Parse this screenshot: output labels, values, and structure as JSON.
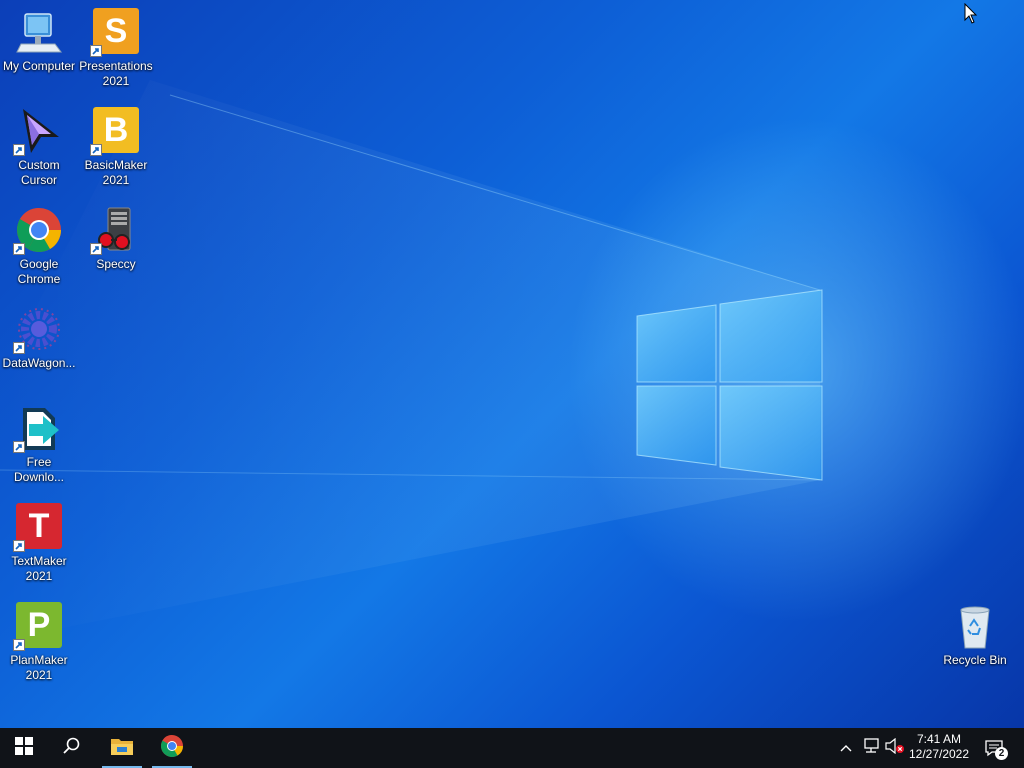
{
  "desktop": {
    "icons": [
      {
        "id": "my-computer",
        "label": "My Computer"
      },
      {
        "id": "presentations",
        "label": "Presentations 2021",
        "letter": "S"
      },
      {
        "id": "custom-cursor",
        "label": "Custom Cursor"
      },
      {
        "id": "basicmaker",
        "label": "BasicMaker 2021",
        "letter": "B"
      },
      {
        "id": "google-chrome",
        "label": "Google Chrome"
      },
      {
        "id": "speccy",
        "label": "Speccy"
      },
      {
        "id": "datawagon",
        "label": "DataWagon..."
      },
      {
        "id": "free-download",
        "label": "Free Downlo..."
      },
      {
        "id": "textmaker",
        "label": "TextMaker 2021",
        "letter": "T"
      },
      {
        "id": "planmaker",
        "label": "PlanMaker 2021",
        "letter": "P"
      },
      {
        "id": "recycle-bin",
        "label": "Recycle Bin"
      }
    ]
  },
  "taskbar": {
    "pinned": [
      "start-windows-icon",
      "search-icon",
      "file-explorer-icon",
      "chrome-icon"
    ],
    "tray": {
      "time": "7:41 AM",
      "date": "12/27/2022",
      "notification_count": "2"
    }
  },
  "colors": {
    "taskbar": "#101318",
    "active_indicator": "#76b9ed",
    "presentations": "#f0a020",
    "basicmaker": "#f2bd22",
    "textmaker": "#d62730",
    "planmaker": "#7cb82f"
  }
}
